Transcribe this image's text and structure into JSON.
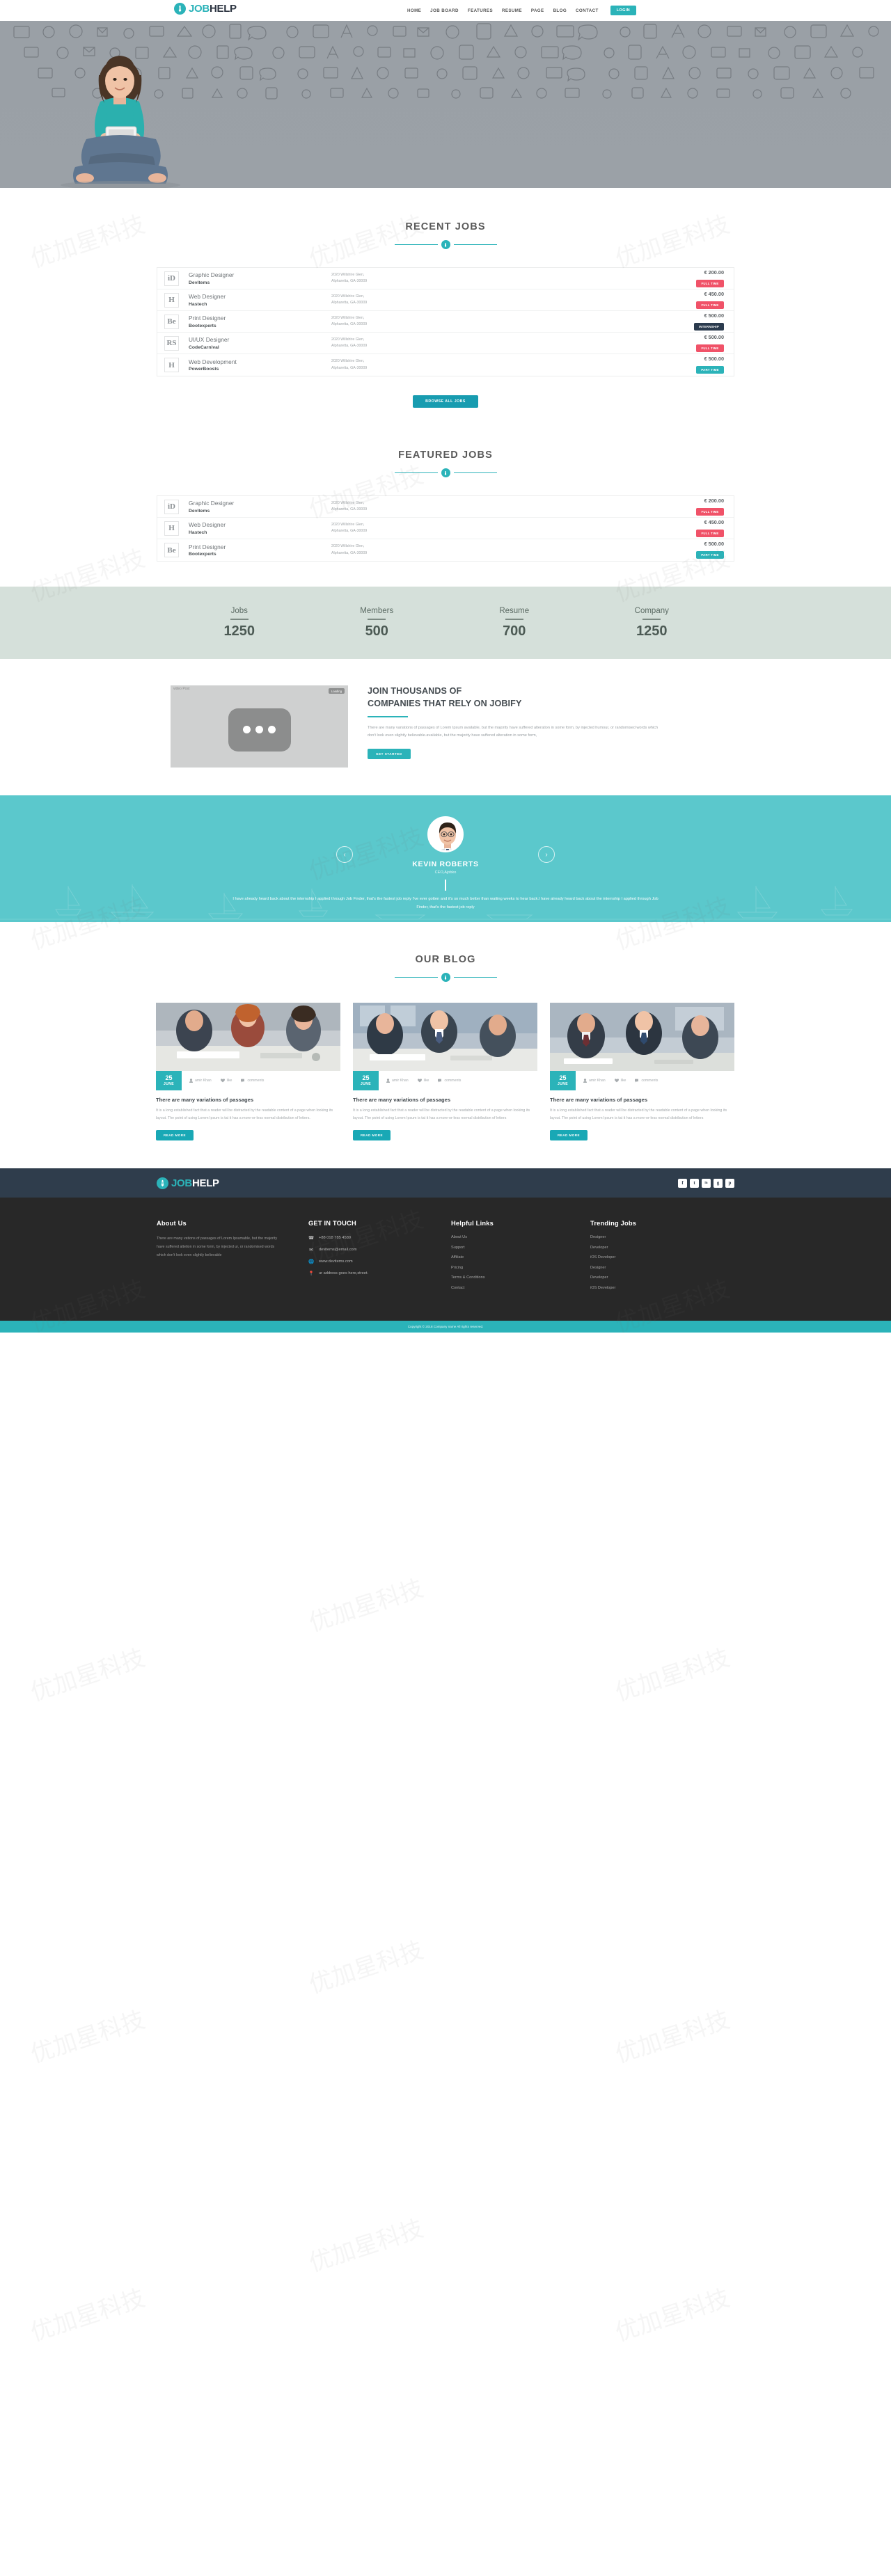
{
  "brand": {
    "name_part1": "JOB",
    "name_part2": "HELP",
    "accent": "#2bb3b9",
    "dark": "#2b3340",
    "tie_icon": "tie-icon"
  },
  "header": {
    "nav": [
      {
        "label": "HOME",
        "active": true
      },
      {
        "label": "JOB BOARD",
        "active": false
      },
      {
        "label": "FEATURES",
        "active": false
      },
      {
        "label": "RESUME",
        "active": false
      },
      {
        "label": "PAGE",
        "active": false
      },
      {
        "label": "BLOG",
        "active": false
      },
      {
        "label": "CONTACT",
        "active": false
      }
    ],
    "login_label": "LOGIN"
  },
  "recent": {
    "title": "RECENT JOBS",
    "browse_label": "BROWSE ALL JOBS",
    "jobs": [
      {
        "logo": "iD",
        "title": "Graphic Designer",
        "company": "Devitems",
        "address_l1": "2020 Willshire Glen,",
        "address_l2": "Alpharetta, GA-30009",
        "price": "€ 200.00",
        "tag": "FULL TIME",
        "tag_type": "full"
      },
      {
        "logo": "H",
        "title": "Web Designer",
        "company": "Hastech",
        "address_l1": "2020 Willshire Glen,",
        "address_l2": "Alpharetta, GA-30009",
        "price": "€ 450.00",
        "tag": "FULL TIME",
        "tag_type": "full"
      },
      {
        "logo": "Be",
        "title": "Print Designer",
        "company": "Bootexperts",
        "address_l1": "2020 Willshire Glen,",
        "address_l2": "Alpharetta, GA-30009",
        "price": "€ 500.00",
        "tag": "INTERNSHIP",
        "tag_type": "intern"
      },
      {
        "logo": "RS",
        "title": "UI/UX Designer",
        "company": "CodeCarnival",
        "address_l1": "2020 Willshire Glen,",
        "address_l2": "Alpharetta, GA-30009",
        "price": "€ 500.00",
        "tag": "FULL TIME",
        "tag_type": "full"
      },
      {
        "logo": "H",
        "title": "Web Development",
        "company": "PowerBoosts",
        "address_l1": "2020 Willshire Glen,",
        "address_l2": "Alpharetta, GA-30009",
        "price": "€ 500.00",
        "tag": "PART TIME",
        "tag_type": "part"
      }
    ]
  },
  "featured": {
    "title": "FEATURED JOBS",
    "jobs": [
      {
        "logo": "iD",
        "title": "Graphic Designer",
        "company": "Devitems",
        "address_l1": "2020 Willshire Glen,",
        "address_l2": "Alpharetta, GA-30009",
        "price": "€ 200.00",
        "tag": "FULL TIME",
        "tag_type": "full"
      },
      {
        "logo": "H",
        "title": "Web Designer",
        "company": "Hastech",
        "address_l1": "2020 Willshire Glen,",
        "address_l2": "Alpharetta, GA-30009",
        "price": "€ 450.00",
        "tag": "FULL TIME",
        "tag_type": "full"
      },
      {
        "logo": "Be",
        "title": "Print Designer",
        "company": "Bootexperts",
        "address_l1": "2020 Willshire Glen,",
        "address_l2": "Alpharetta, GA-30009",
        "price": "€ 500.00",
        "tag": "PART TIME",
        "tag_type": "part"
      }
    ]
  },
  "stats": [
    {
      "label": "Jobs",
      "value": "1250"
    },
    {
      "label": "Members",
      "value": "500"
    },
    {
      "label": "Resume",
      "value": "700"
    },
    {
      "label": "Company",
      "value": "1250"
    }
  ],
  "cta": {
    "video_label": "video Post",
    "video_loading": "Loading",
    "heading_l1": "JOIN THOUSANDS OF",
    "heading_l2": "COMPANIES THAT RELY ON JOBIFY",
    "body": "There are many variations of passages of Lorem Ipsum available, but the majority have suffered alteration in some form, by injected humour, or randomised words which don't look even slightly believable.available, but the majority have suffered alteration in some form,",
    "button_label": "GET STARTED"
  },
  "testimonial": {
    "name": "KEVIN ROBERTS",
    "role": "CEO,Ajobko",
    "quote": "I have already heard back about the internship I applied through Job Finder, that's the fastest job reply I've ever gotten and it's so much better than waiting weeks to hear back.I have already heard back about the internship I applied through Job Finder, that's the fastest job reply",
    "prev_icon": "chevron-left-icon",
    "next_icon": "chevron-right-icon"
  },
  "blog": {
    "title": "OUR BLOG",
    "posts": [
      {
        "day": "25",
        "month": "JUNE",
        "author": "amir Khan",
        "likes": "like",
        "comments": "comments",
        "title": "There are many variations of passages",
        "text": "It is a long established fact that a reader will be distracted by the readable content of a page when looking its layout. The point of using Lorem Ipsum is tat it has a more-or-less normal distribution of letters.",
        "button_label": "READ MORE"
      },
      {
        "day": "25",
        "month": "JUNE",
        "author": "amir Khan",
        "likes": "like",
        "comments": "comments",
        "title": "There are many variations of passages",
        "text": "It is a long established fact that a reader will be distracted by the readable content of a page when looking its layout. The point of using Lorem Ipsum is tat it has a more-or-less normal distribution of letters",
        "button_label": "READ MORE"
      },
      {
        "day": "25",
        "month": "JUNE",
        "author": "amir Khan",
        "likes": "like",
        "comments": "comments",
        "title": "There are many variations of passages",
        "text": "It is a long established fact that a reader will be distracted by the readable content of a page when looking its layout. The point of using Lorem Ipsum is tat it has a more-or-less normal distribution of letters",
        "button_label": "READ MORE"
      }
    ]
  },
  "footer": {
    "socials": [
      {
        "name": "facebook-icon",
        "glyph": "f"
      },
      {
        "name": "twitter-icon",
        "glyph": "t"
      },
      {
        "name": "linkedin-icon",
        "glyph": "in"
      },
      {
        "name": "google-plus-icon",
        "glyph": "g"
      },
      {
        "name": "pinterest-icon",
        "glyph": "p"
      }
    ],
    "about": {
      "heading": "About Us",
      "text": "There are many vations of passages of Lorem Ipsumable, but the majority have suffered altetion in some form, by injected ur, or randomised words which don't look even slightly believable"
    },
    "touch": {
      "heading": "GET IN TOUCH",
      "items": [
        {
          "icon": "phone-icon",
          "text": "+88 018 785 4589"
        },
        {
          "icon": "envelope-icon",
          "text": "devitems@email.com"
        },
        {
          "icon": "globe-icon",
          "text": "www.devitems.com"
        },
        {
          "icon": "map-marker-icon",
          "text": "ur address goes here,street."
        }
      ]
    },
    "helpful": {
      "heading": "Helpful Links",
      "items": [
        "About Us",
        "Support",
        "Affiliate",
        "Pricing",
        "Terms & Conditions",
        "Contact"
      ]
    },
    "trending": {
      "heading": "Trending Jobs",
      "items": [
        "Designer",
        "Developer",
        "iOS Developer",
        "Designer",
        "Developer",
        "iOS Developer"
      ]
    },
    "copyright": "Copyright © 2018 Company name All rights reserved."
  }
}
